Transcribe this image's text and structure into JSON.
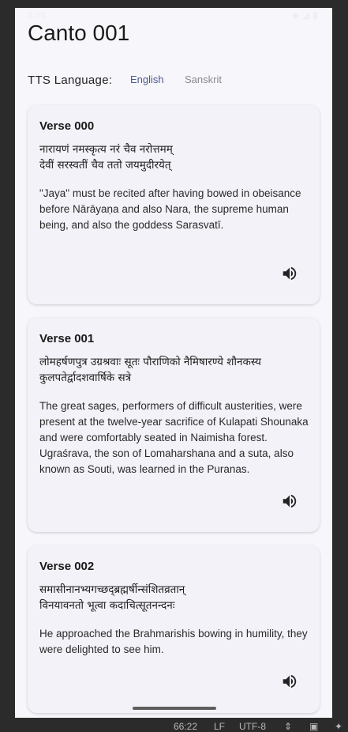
{
  "status_bar": {
    "time": "8:56"
  },
  "header": {
    "title": "Canto 001"
  },
  "tts": {
    "label": "TTS Language:",
    "options": [
      "English",
      "Sanskrit"
    ],
    "selected": "English"
  },
  "verses": [
    {
      "title": "Verse 000",
      "sanskrit": [
        "नारायणं नमस्कृत्य नरं चैव नरोत्तमम्",
        "देवीं सरस्वतीं चैव ततो जयमुदीरयेत्"
      ],
      "english": "\"Jaya\" must be recited after having bowed in obeisance before Nārāyaṇa and also Nara, the supreme human being, and also the goddess Sarasvatī."
    },
    {
      "title": "Verse 001",
      "sanskrit": [
        "लोमहर्षणपुत्र उग्रश्रवाः सूतः पौराणिको नैमिषारण्ये शौनकस्य",
        "कुलपतेर्द्वादशवार्षिके सत्रे"
      ],
      "english": "The great sages, performers of difficult austerities, were present at the twelve-year sacrifice of Kulapati Shounaka and were comfortably seated in Naimisha forest. Ugraśrava, the son of Lomaharshana and a suta, also known as Souti, was learned in the Puranas."
    },
    {
      "title": "Verse 002",
      "sanskrit": [
        "समासीनानभ्यगच्छद्ब्रह्मर्षीन्संशितव्रतान्",
        "विनयावनतो भूत्वा कदाचित्सूतनन्दनः"
      ],
      "english": "He approached the Brahmarishis bowing in humility, they were delighted to see him."
    }
  ],
  "ide_status": {
    "position": "66:22",
    "line_ending": "LF",
    "encoding": "UTF-8"
  },
  "icons": {
    "speaker": "volume-up-icon"
  }
}
